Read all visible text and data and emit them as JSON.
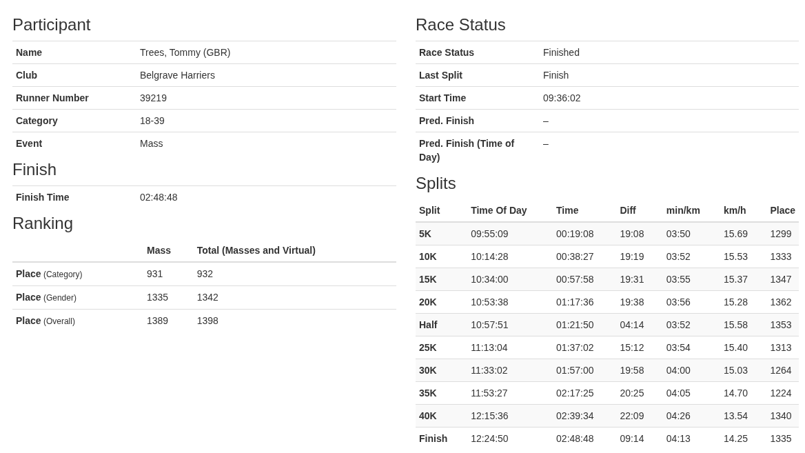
{
  "participant": {
    "title": "Participant",
    "rows": [
      {
        "label": "Name",
        "value": "Trees, Tommy (GBR)"
      },
      {
        "label": "Club",
        "value": "Belgrave Harriers"
      },
      {
        "label": "Runner Number",
        "value": "39219"
      },
      {
        "label": "Category",
        "value": "18-39"
      },
      {
        "label": "Event",
        "value": "Mass"
      }
    ]
  },
  "finish": {
    "title": "Finish",
    "rows": [
      {
        "label": "Finish Time",
        "value": "02:48:48"
      }
    ]
  },
  "ranking": {
    "title": "Ranking",
    "columns": [
      "Mass",
      "Total (Masses and Virtual)"
    ],
    "rows": [
      {
        "label": "**Place** (Category)",
        "values": [
          "931",
          "932"
        ]
      },
      {
        "label": "**Place** (Gender)",
        "values": [
          "1335",
          "1342"
        ]
      },
      {
        "label": "**Place** (Overall)",
        "values": [
          "1389",
          "1398"
        ]
      }
    ]
  },
  "race_status": {
    "title": "Race Status",
    "rows": [
      {
        "label": "Race Status",
        "value": "Finished"
      },
      {
        "label": "Last Split",
        "value": "Finish"
      },
      {
        "label": "Start Time",
        "value": "09:36:02"
      },
      {
        "label": "Pred. Finish",
        "value": "–"
      },
      {
        "label": "Pred. Finish (Time of Day)",
        "value": "–"
      }
    ]
  },
  "splits": {
    "title": "Splits",
    "columns": [
      "Split",
      "Time Of Day",
      "Time",
      "Diff",
      "min/km",
      "km/h",
      "Place"
    ],
    "rows": [
      [
        "5K",
        "09:55:09",
        "00:19:08",
        "19:08",
        "03:50",
        "15.69",
        "1299"
      ],
      [
        "10K",
        "10:14:28",
        "00:38:27",
        "19:19",
        "03:52",
        "15.53",
        "1333"
      ],
      [
        "15K",
        "10:34:00",
        "00:57:58",
        "19:31",
        "03:55",
        "15.37",
        "1347"
      ],
      [
        "20K",
        "10:53:38",
        "01:17:36",
        "19:38",
        "03:56",
        "15.28",
        "1362"
      ],
      [
        "Half",
        "10:57:51",
        "01:21:50",
        "04:14",
        "03:52",
        "15.58",
        "1353"
      ],
      [
        "25K",
        "11:13:04",
        "01:37:02",
        "15:12",
        "03:54",
        "15.40",
        "1313"
      ],
      [
        "30K",
        "11:33:02",
        "01:57:00",
        "19:58",
        "04:00",
        "15.03",
        "1264"
      ],
      [
        "35K",
        "11:53:27",
        "02:17:25",
        "20:25",
        "04:05",
        "14.70",
        "1224"
      ],
      [
        "40K",
        "12:15:36",
        "02:39:34",
        "22:09",
        "04:26",
        "13.54",
        "1340"
      ],
      [
        "Finish",
        "12:24:50",
        "02:48:48",
        "09:14",
        "04:13",
        "14.25",
        "1335"
      ]
    ]
  }
}
